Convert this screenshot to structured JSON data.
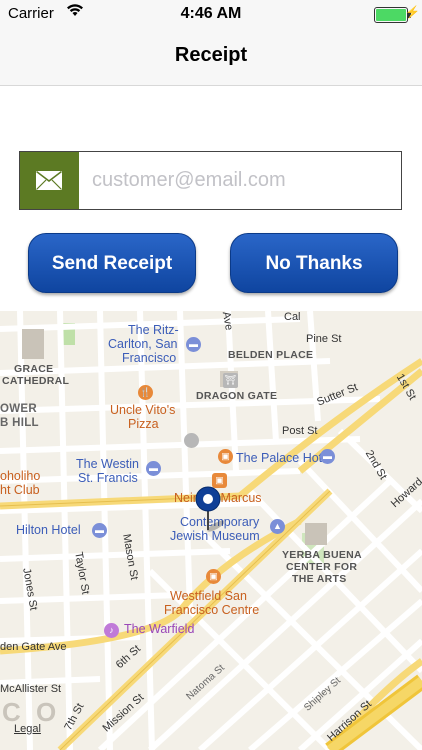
{
  "status_bar": {
    "carrier": "Carrier",
    "time": "4:46 AM",
    "battery_color": "#4cd964"
  },
  "navbar": {
    "title": "Receipt"
  },
  "email": {
    "placeholder": "customer@email.com",
    "value": "",
    "icon": "envelope-icon",
    "icon_bg": "#5c7a23"
  },
  "buttons": {
    "send_receipt": "Send Receipt",
    "no_thanks": "No Thanks",
    "color": "#1a55b6"
  },
  "map": {
    "pois": {
      "ritz1": "The Ritz-",
      "ritz2": "Carlton, San",
      "ritz3": "Francisco",
      "belden": "BELDEN PLACE",
      "grace1": "GRACE",
      "grace2": "CATHEDRAL",
      "dragon": "DRAGON GATE",
      "vito1": "Uncle Vito's",
      "vito2": "Pizza",
      "westin1": "The Westin",
      "westin2": "St. Francis",
      "palace": "The Palace Hotel",
      "neiman": "Neiman Marcus",
      "cjm1": "Contemporary",
      "cjm2": "Jewish Museum",
      "hilton": "Hilton Hotel",
      "yb1": "YERBA BUENA",
      "yb2": "CENTER FOR",
      "yb3": "THE ARTS",
      "westfield1": "Westfield San",
      "westfield2": "Francisco Centre",
      "warfield": "The Warfield",
      "tower1": "OWER",
      "tower2": "B HILL",
      "oholiho1": "oholiho",
      "oholiho2": "ht Club",
      "co": "C O"
    },
    "streets": {
      "pine": "Pine St",
      "sutter": "Sutter St",
      "post": "Post St",
      "first": "1st St",
      "second": "2nd St",
      "howard": "Howard",
      "jones": "Jones St",
      "taylor": "Taylor St",
      "mason": "Mason St",
      "sixth": "6th St",
      "seventh": "7th St",
      "mission": "Mission St",
      "natoma": "Natoma St",
      "shipley": "Shipley St",
      "harrison": "Harrison St",
      "mcallister": "McAllister St",
      "goldengate": "den Gate Ave",
      "cal": "Cal",
      "ave": "Ave"
    },
    "legal": "Legal"
  }
}
